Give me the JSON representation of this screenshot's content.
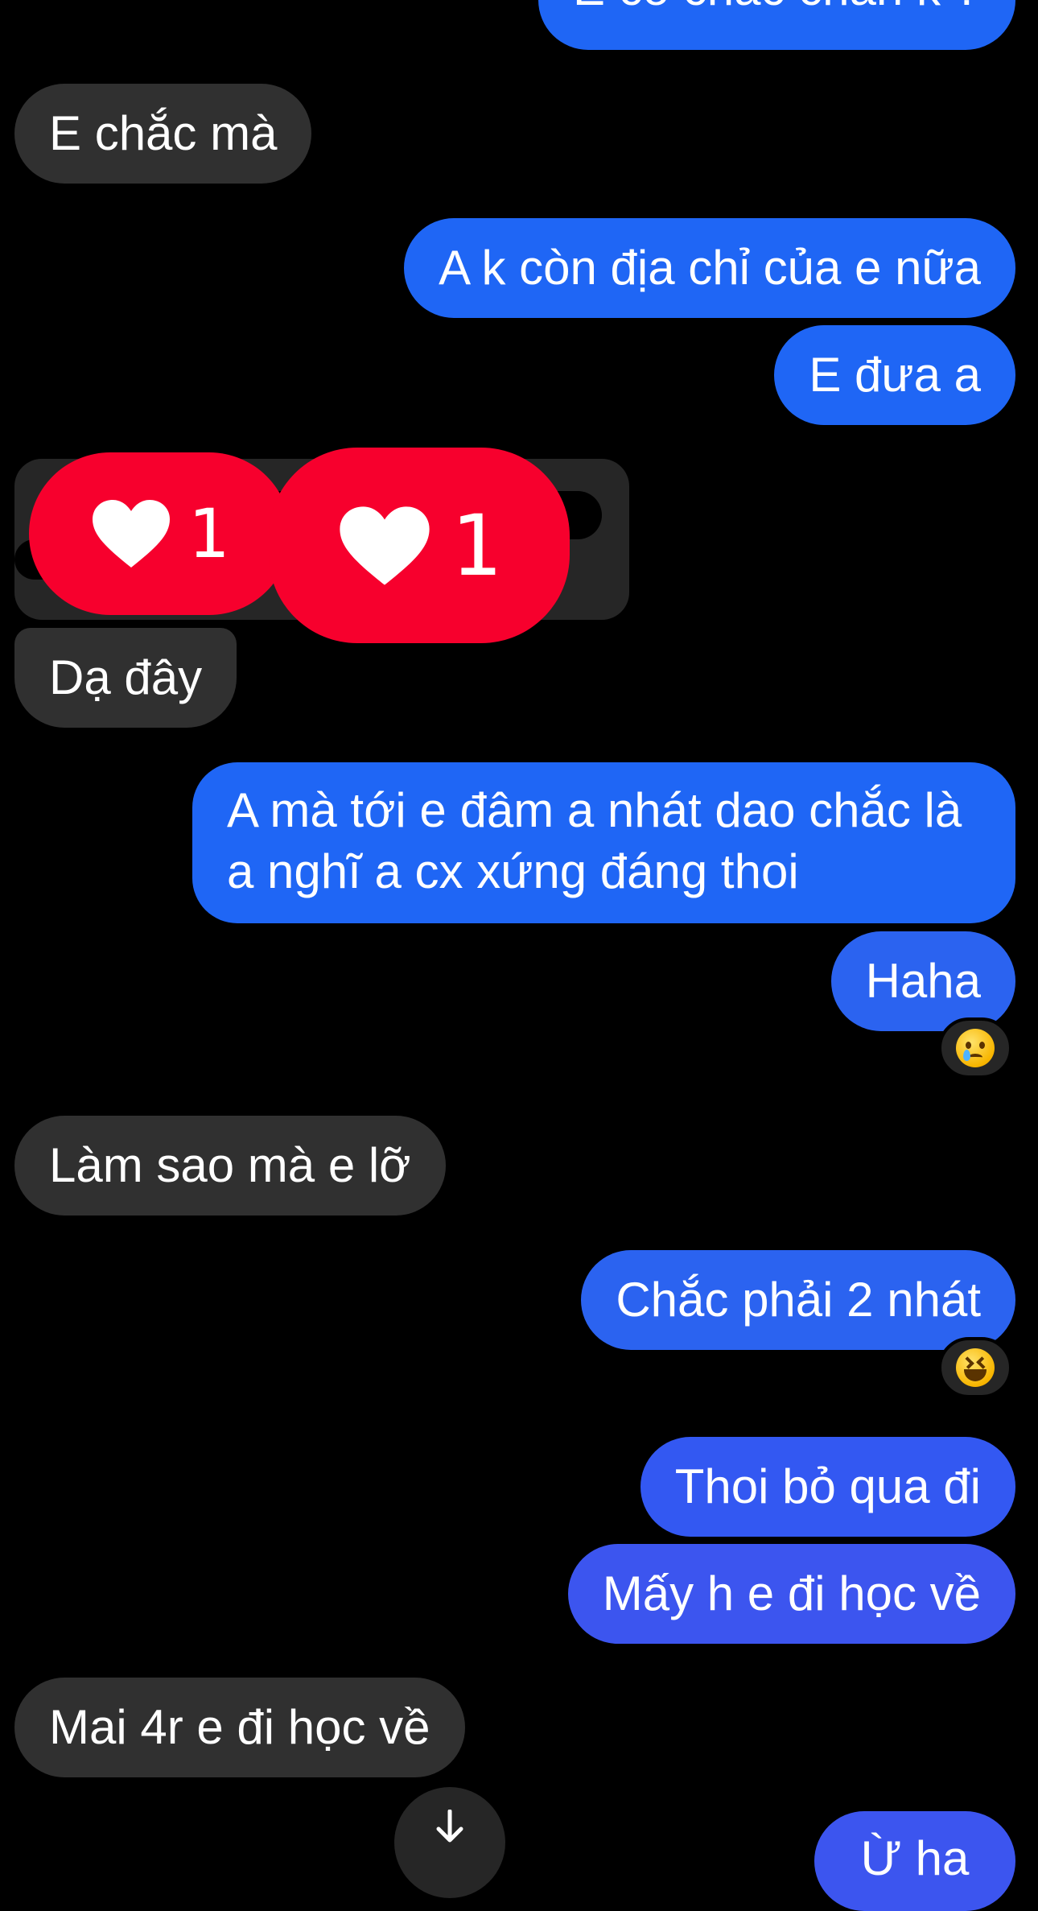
{
  "messages": [
    {
      "id": "m0",
      "side": "out",
      "text": "E có chắc chắn k ?"
    },
    {
      "id": "m1",
      "side": "in",
      "text": "E chắc mà"
    },
    {
      "id": "m2",
      "side": "out",
      "text": "A k còn địa chỉ của e nữa"
    },
    {
      "id": "m3",
      "side": "out",
      "text": "E đưa a"
    },
    {
      "id": "m4",
      "side": "in",
      "text": "Dạ đây"
    },
    {
      "id": "m5",
      "side": "out",
      "text": "A mà tới e đâm a nhát dao chắc là a nghĩ a cx xứng đáng thoi"
    },
    {
      "id": "m6",
      "side": "out",
      "text": "Haha",
      "reaction": "crying-face-emoji"
    },
    {
      "id": "m7",
      "side": "in",
      "text": "Làm sao mà e lỡ"
    },
    {
      "id": "m8",
      "side": "out",
      "text": "Chắc phải 2 nhát",
      "reaction": "laughing-face-emoji"
    },
    {
      "id": "m9",
      "side": "out",
      "text": "Thoi bỏ qua đi"
    },
    {
      "id": "m10",
      "side": "out",
      "text": "Mấy h e đi học về"
    },
    {
      "id": "m11",
      "side": "in",
      "text": "Mai 4r e đi học về"
    },
    {
      "id": "m12",
      "side": "out",
      "text": "Ừ ha"
    }
  ],
  "like_badges": [
    {
      "count": "1",
      "icon": "heart-icon"
    },
    {
      "count": "1",
      "icon": "heart-icon"
    }
  ],
  "colors": {
    "incoming_bubble": "#303030",
    "outgoing_bubble": "#1f66f5",
    "like_badge": "#f7002d",
    "background": "#000000"
  },
  "scroll_button": {
    "icon": "arrow-down-icon"
  }
}
